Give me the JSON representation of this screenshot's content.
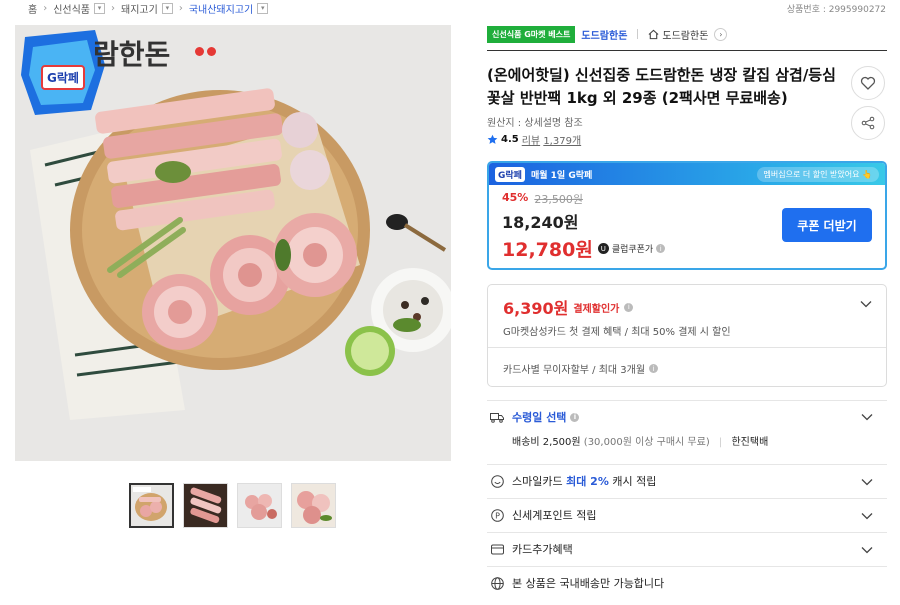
{
  "breadcrumb": {
    "home": "홈",
    "level1": "신선식품",
    "level2": "돼지고기",
    "level3": "국내산돼지고기"
  },
  "product_no": "상품번호 : 2995990272",
  "image": {
    "logo_text": "람한돈",
    "gdeal_badge_text": "G락페"
  },
  "store": {
    "best_badge": "신선식품 G마켓 베스트",
    "brand": "도드람한돈",
    "shop_name": "도드람한돈"
  },
  "product": {
    "title": "(온에어핫딜) 신선집중 도드람한돈 냉장 칼집 삼겹/등심꽃살 반반팩 1kg 외 29종 (2팩사면 무료배송)",
    "origin": "원산지 : 상세설명 참조",
    "rating": "4.5",
    "review_prefix": "리뷰",
    "review_count": "1,379개"
  },
  "gdeal": {
    "logo": "G락페",
    "title": "매월 1일 G락페",
    "subtitle": "멤버십으로 더 할인 받았어요 👆",
    "discount_pct": "45%",
    "original_price": "23,500원",
    "sale_price": "18,240원",
    "coupon_price": "12,780원",
    "club_label": "클럽쿠폰가",
    "coupon_button": "쿠폰 더받기"
  },
  "card_benefit": {
    "price": "6,390원",
    "label": "결제할인가",
    "desc": "G마켓삼성카드 첫 결제 혜택 / 최대 50% 결제 시 할인",
    "installment": "카드사별 무이자할부 / 최대 3개월"
  },
  "delivery": {
    "title": "수령일 선택",
    "fee": "배송비 2,500원",
    "fee_note": "(30,000원 이상 구매시 무료)",
    "courier": "한진택배"
  },
  "benefits": {
    "smilecard_prefix": "스마일카드",
    "smilecard_highlight": "최대 2%",
    "smilecard_suffix": "캐시 적립",
    "shinsegae": "신세계포인트 적립",
    "card_extra": "카드추가혜택",
    "domestic": "본 상품은 국내배송만 가능합니다"
  },
  "colors": {
    "accent_blue": "#2a5bd7",
    "price_red": "#e02f2f",
    "best_green": "#1fae3b",
    "coupon_button": "#1f6fef"
  }
}
